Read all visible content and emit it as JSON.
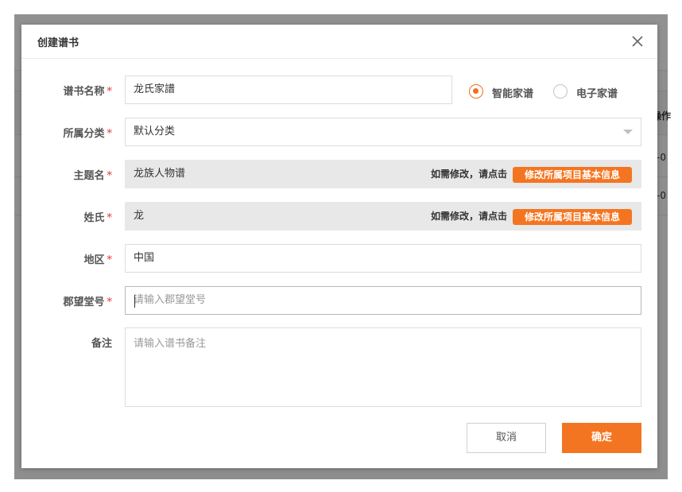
{
  "background": {
    "column_header": "操作",
    "cells": [
      "-0",
      "-0"
    ]
  },
  "dialog": {
    "title": "创建谱书",
    "required_mark": "*",
    "fields": {
      "name": {
        "label": "谱书名称",
        "value": "龙氏家譜"
      },
      "category": {
        "label": "所属分类",
        "value": "默认分类"
      },
      "theme": {
        "label": "主题名",
        "value": "龙族人物谱",
        "hint": "如需修改，请点击",
        "button": "修改所属项目基本信息"
      },
      "surname": {
        "label": "姓氏",
        "value": "龙",
        "hint": "如需修改，请点击",
        "button": "修改所属项目基本信息"
      },
      "region": {
        "label": "地区",
        "value": "中国"
      },
      "hall": {
        "label": "郡望堂号",
        "placeholder": "请输入郡望堂号"
      },
      "remark": {
        "label": "备注",
        "placeholder": "请输入谱书备注"
      }
    },
    "type_options": [
      {
        "label": "智能家谱",
        "checked": true
      },
      {
        "label": "电子家谱",
        "checked": false
      }
    ],
    "buttons": {
      "cancel": "取消",
      "confirm": "确定"
    }
  },
  "colors": {
    "accent": "#f47521",
    "required": "#e53935"
  }
}
